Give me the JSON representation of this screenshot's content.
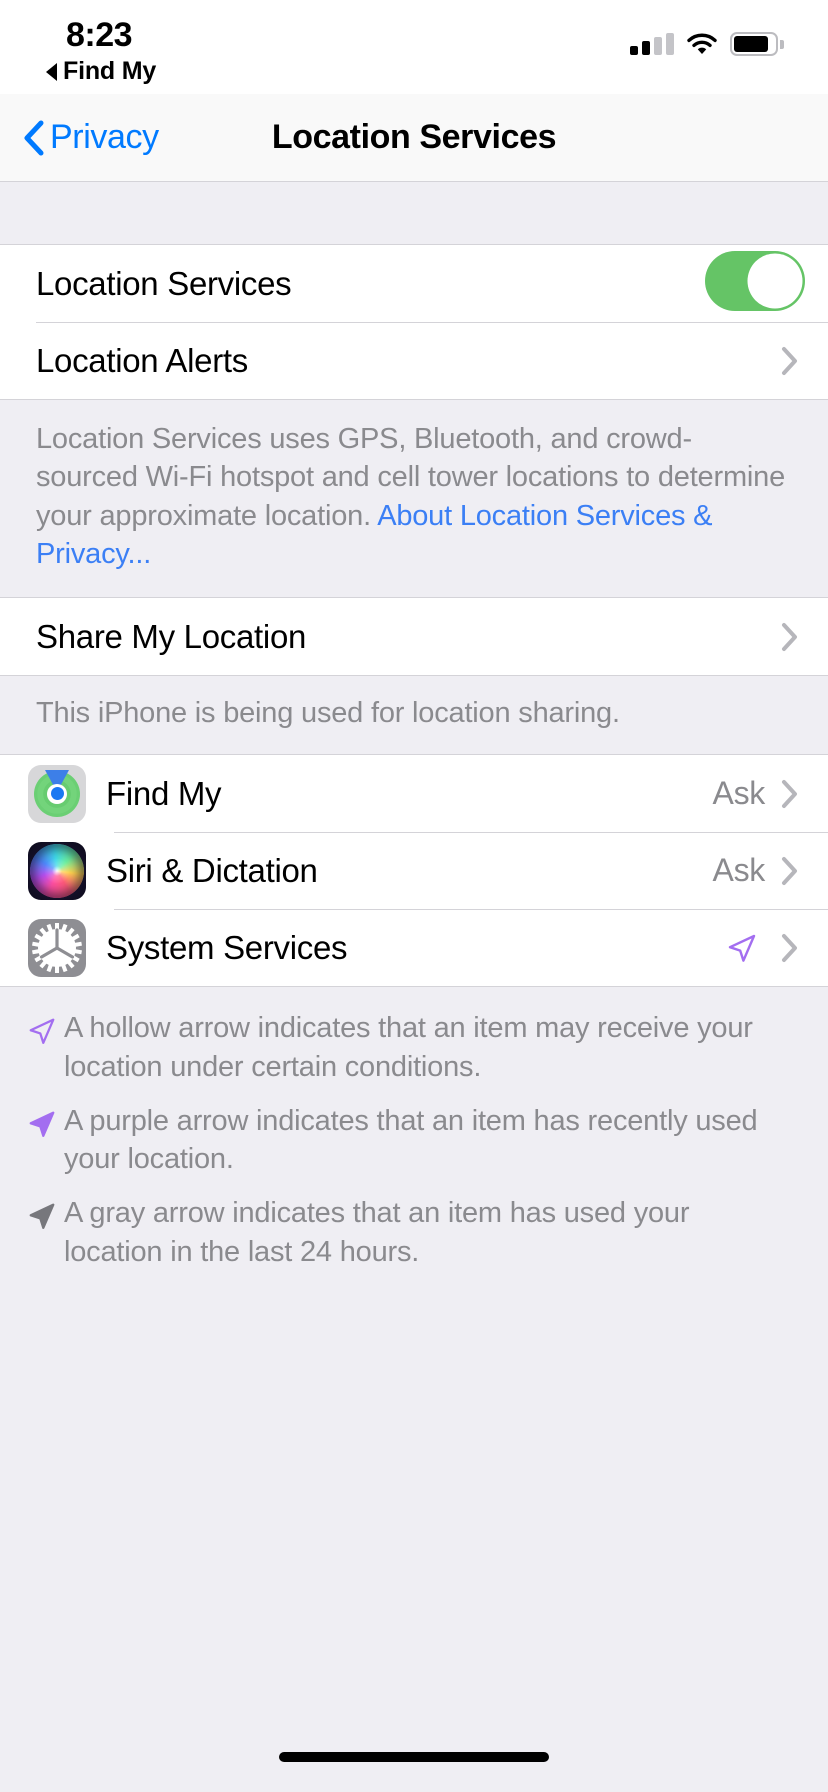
{
  "status_bar": {
    "time": "8:23",
    "back_app_label": "Find My",
    "back_triangle_icon": "triangle-left-icon",
    "cellular_icon": "cellular-signal-icon",
    "cellular_bars_filled": 2,
    "cellular_bars_total": 4,
    "wifi_icon": "wifi-icon",
    "battery_icon": "battery-icon"
  },
  "nav": {
    "back_label": "Privacy",
    "back_icon": "chevron-left-icon",
    "title": "Location Services"
  },
  "sections": {
    "main": {
      "location_services": {
        "label": "Location Services",
        "toggle_on": true,
        "toggle_color": "#65c466"
      },
      "location_alerts": {
        "label": "Location Alerts",
        "chevron_icon": "chevron-right-icon"
      },
      "footer_text": "Location Services uses GPS, Bluetooth, and crowd-sourced Wi-Fi hotspot and cell tower locations to determine your approximate location. ",
      "footer_link": "About Location Services & Privacy...",
      "footer_link_color": "#3b7ff5"
    },
    "sharing": {
      "share_my_location": {
        "label": "Share My Location",
        "chevron_icon": "chevron-right-icon"
      },
      "footer_text": "This iPhone is being used for location sharing."
    },
    "apps": {
      "items": [
        {
          "label": "Find My",
          "value": "Ask",
          "icon": "find-my-app-icon",
          "arrow": "none"
        },
        {
          "label": "Siri & Dictation",
          "value": "Ask",
          "icon": "siri-app-icon",
          "arrow": "none"
        },
        {
          "label": "System Services",
          "value": "",
          "icon": "system-services-gear-icon",
          "arrow": "hollow-purple-arrow-icon"
        }
      ]
    },
    "legend": {
      "items": [
        {
          "arrow_icon": "hollow-purple-arrow-icon",
          "text": "A hollow arrow indicates that an item may receive your location under certain conditions."
        },
        {
          "arrow_icon": "solid-purple-arrow-icon",
          "text": "A purple arrow indicates that an item has recently used your location."
        },
        {
          "arrow_icon": "solid-gray-arrow-icon",
          "text": "A gray arrow indicates that an item has used your location in the last 24 hours."
        }
      ]
    }
  },
  "home_indicator": "home-indicator"
}
